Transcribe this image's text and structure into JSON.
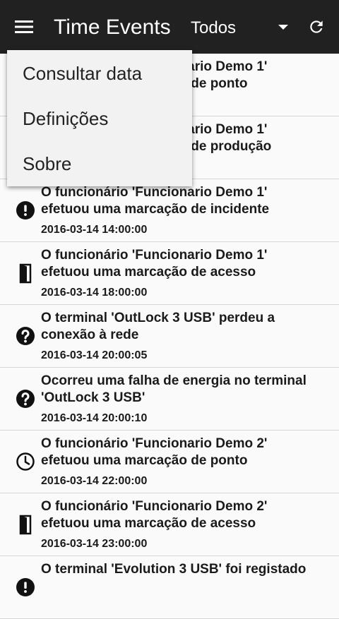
{
  "app": {
    "title": "Time Events",
    "filter_value": "Todos"
  },
  "icons": {
    "menu": "hamburger-icon",
    "refresh": "refresh-icon",
    "dropdown": "dropdown-arrow-icon"
  },
  "dropdown_menu": {
    "items": [
      {
        "label": "Consultar data"
      },
      {
        "label": "Definições"
      },
      {
        "label": "Sobre"
      }
    ]
  },
  "events": [
    {
      "icon": "clock-icon",
      "text": "O funcionário 'Funcionario Demo 1'\nefetuou uma marcação de ponto",
      "date": ""
    },
    {
      "icon": "gear-icon",
      "text": "O funcionário 'Funcionario Demo 1'\nefetuou uma marcação de produção",
      "date": ""
    },
    {
      "icon": "alert-icon",
      "text": "O funcionário 'Funcionario Demo 1'\nefetuou uma marcação de incidente",
      "date": "2016-03-14 14:00:00"
    },
    {
      "icon": "door-icon",
      "text": "O funcionário 'Funcionario Demo 1'\nefetuou uma marcação de acesso",
      "date": "2016-03-14 18:00:00"
    },
    {
      "icon": "help-icon",
      "text": "O terminal 'OutLock 3 USB' perdeu a\nconexão à rede",
      "date": "2016-03-14 20:00:05"
    },
    {
      "icon": "help-icon",
      "text": "Ocorreu uma falha de energia no terminal\n'OutLock 3 USB'",
      "date": "2016-03-14 20:00:10"
    },
    {
      "icon": "clock-icon",
      "text": "O funcionário 'Funcionario Demo 2'\nefetuou uma marcação de ponto",
      "date": "2016-03-14 22:00:00"
    },
    {
      "icon": "door-icon",
      "text": "O funcionário 'Funcionario Demo 2'\nefetuou uma marcação de acesso",
      "date": "2016-03-14 23:00:00"
    },
    {
      "icon": "alert-icon",
      "text": "O terminal 'Evolution 3 USB' foi registado",
      "date": ""
    }
  ]
}
